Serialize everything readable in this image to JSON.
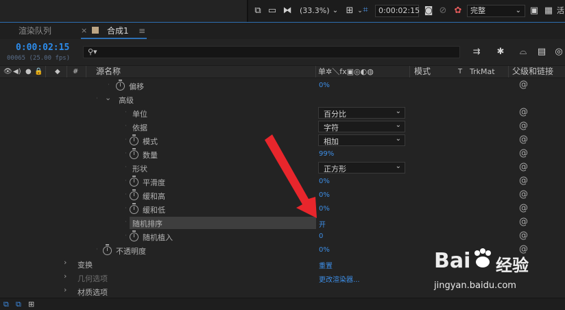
{
  "toolbar": {
    "zoom": "(33.3%)",
    "timecode": "0:00:02:15",
    "resolution": "完整",
    "edge_char": "活"
  },
  "tabs": {
    "render_queue": "渲染队列",
    "close": "×",
    "comp": "合成1",
    "menu": "≡"
  },
  "timecode": {
    "main": "0:00:02:15",
    "sub": "00065 (25.00 fps)"
  },
  "search": {
    "icon": "search-icon"
  },
  "header": {
    "hash": "#",
    "source_name": "源名称",
    "switch_icons": "单✲＼fx▣◎◐◍",
    "mode": "模式",
    "t": "T",
    "trkmat": "TrkMat",
    "parent": "父级和链接"
  },
  "rows": [
    {
      "name": "偏移",
      "value": "0%",
      "stopwatch": true,
      "indent": 2
    },
    {
      "name": "高级",
      "group": true,
      "expanded": true,
      "indent": 1
    },
    {
      "name": "单位",
      "dropdown": "百分比",
      "indent": 3
    },
    {
      "name": "依据",
      "dropdown": "字符",
      "indent": 3
    },
    {
      "name": "模式",
      "dropdown": "相加",
      "stopwatch": true,
      "indent": 3
    },
    {
      "name": "数量",
      "value": "99%",
      "stopwatch": true,
      "indent": 3
    },
    {
      "name": "形状",
      "dropdown": "正方形",
      "indent": 3
    },
    {
      "name": "平滑度",
      "value": "0%",
      "stopwatch": true,
      "indent": 3
    },
    {
      "name": "缓和高",
      "value": "0%",
      "stopwatch": true,
      "indent": 3
    },
    {
      "name": "缓和低",
      "value": "0%",
      "stopwatch": true,
      "indent": 3
    },
    {
      "name": "随机排序",
      "value": "开",
      "selected": true,
      "indent": 3
    },
    {
      "name": "随机植入",
      "value": "0",
      "stopwatch": true,
      "indent": 3
    },
    {
      "name": "不透明度",
      "value": "0%",
      "stopwatch": true,
      "indent": 0
    },
    {
      "name": "变换",
      "value": "重置",
      "group": true,
      "expanded": false,
      "indent": -1
    },
    {
      "name": "几何选项",
      "value": "更改渲染器...",
      "group": true,
      "expanded": false,
      "dim": true,
      "indent": -1
    },
    {
      "name": "材质选项",
      "group": true,
      "expanded": false,
      "indent": -1
    }
  ],
  "watermark": {
    "brand_left": "Bai",
    "brand_right": "经验",
    "url": "jingyan.baidu.com"
  },
  "colors": {
    "accent_blue": "#2d8ceb",
    "arrow_red": "#e8262c"
  }
}
